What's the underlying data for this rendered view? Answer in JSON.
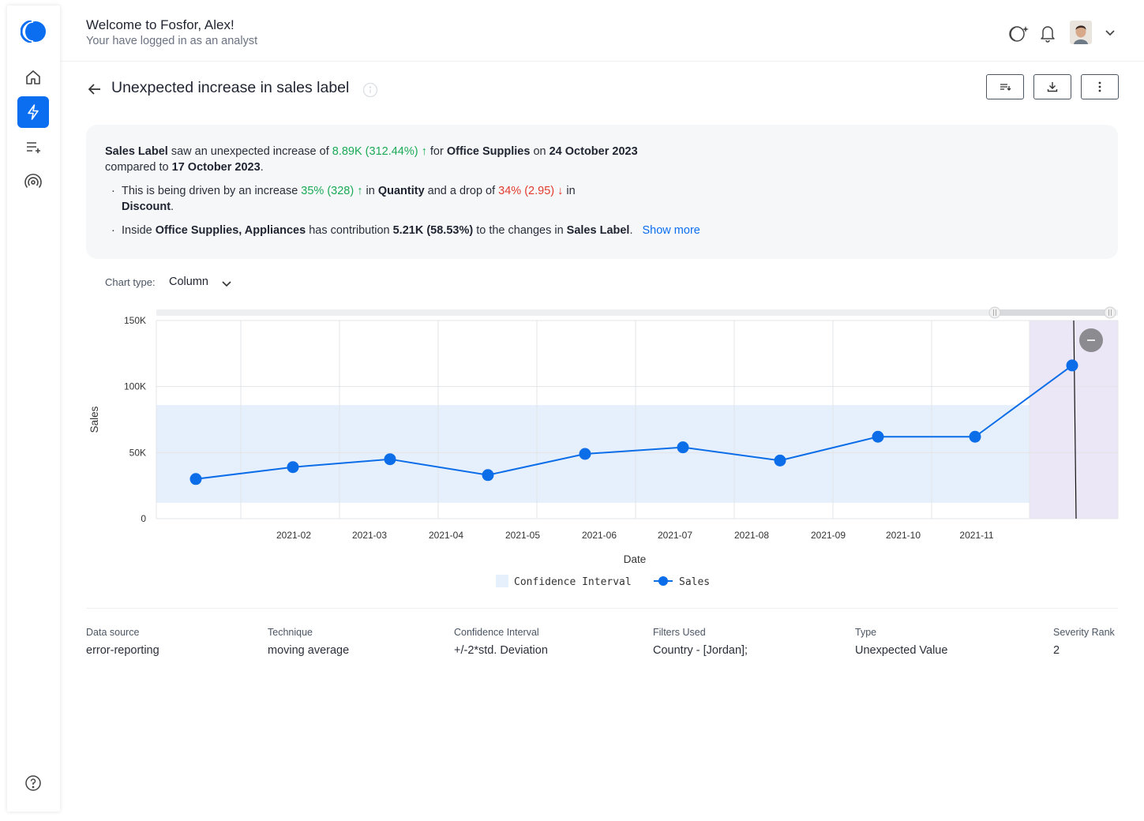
{
  "header": {
    "welcome": "Welcome to Fosfor, Alex!",
    "subtitle": "Your have logged in as an analyst"
  },
  "page": {
    "title": "Unexpected increase in sales label"
  },
  "summary": {
    "p1_a": "Sales Label",
    "p1_b": " saw an unexpected increase of ",
    "p1_c": "8.89K (312.44%)",
    "p1_d": " for ",
    "p1_e": "Office Supplies",
    "p1_f": " on ",
    "p1_g": "24 October 2023",
    "p1_h": " compared to ",
    "p1_i": "17 October 2023",
    "p1_j": ".",
    "b1_a": "This is being driven by an increase ",
    "b1_b": "35% (328)",
    "b1_c": " in ",
    "b1_d": "Quantity",
    "b1_e": " and a drop of ",
    "b1_f": "34% (2.95)",
    "b1_g": " in",
    "b1_h": "Discount",
    "b1_i": ".",
    "b2_a": "Inside ",
    "b2_b": "Office Supplies, Appliances",
    "b2_c": " has contribution ",
    "b2_d": "5.21K (58.53%)",
    "b2_e": " to the changes in ",
    "b2_f": "Sales Label",
    "b2_g": ".",
    "show_more": "Show more"
  },
  "chart_type": {
    "label": "Chart type:",
    "value": "Column"
  },
  "chart_data": {
    "type": "line",
    "xlabel": "Date",
    "ylabel": "Sales",
    "ylim": [
      0,
      150000
    ],
    "yticks": [
      "0",
      "50K",
      "100K",
      "150K"
    ],
    "ytick_values": [
      0,
      50000,
      100000,
      150000
    ],
    "xtick_labels": [
      "2021-02",
      "2021-03",
      "2021-04",
      "2021-05",
      "2021-06",
      "2021-07",
      "2021-08",
      "2021-09",
      "2021-10",
      "2021-11"
    ],
    "series": [
      {
        "name": "Sales",
        "values": [
          30000,
          39000,
          45000,
          33000,
          49000,
          54000,
          44000,
          62000,
          62000,
          116000
        ],
        "color": "#0b6de8"
      }
    ],
    "confidence_interval": {
      "name": "Confidence Interval",
      "lower": 12000,
      "upper": 86000,
      "color": "#e6f0fd"
    },
    "highlight_color": "#ece7f6",
    "grid": true,
    "legend_position": "bottom"
  },
  "meta": [
    {
      "key": "Data source",
      "value": "error-reporting"
    },
    {
      "key": "Technique",
      "value": "moving average"
    },
    {
      "key": "Confidence Interval",
      "value": "+/-2*std. Deviation"
    },
    {
      "key": "Filters Used",
      "value": "Country - [Jordan];"
    },
    {
      "key": "Type",
      "value": "Unexpected Value"
    },
    {
      "key": "Severity Rank",
      "value": "2"
    }
  ],
  "icons": [
    "logo-icon",
    "home-icon",
    "lightning-icon",
    "playlist-add-icon",
    "broadcast-icon",
    "help-icon",
    "ai-sparkle-icon",
    "bell-icon",
    "avatar",
    "chevron-down-icon",
    "back-arrow-icon",
    "info-icon",
    "sort-icon",
    "download-icon",
    "more-vertical-icon"
  ],
  "colors": {
    "primary": "#0b6df0",
    "positive": "#1aaa55",
    "negative": "#e23b2e"
  }
}
